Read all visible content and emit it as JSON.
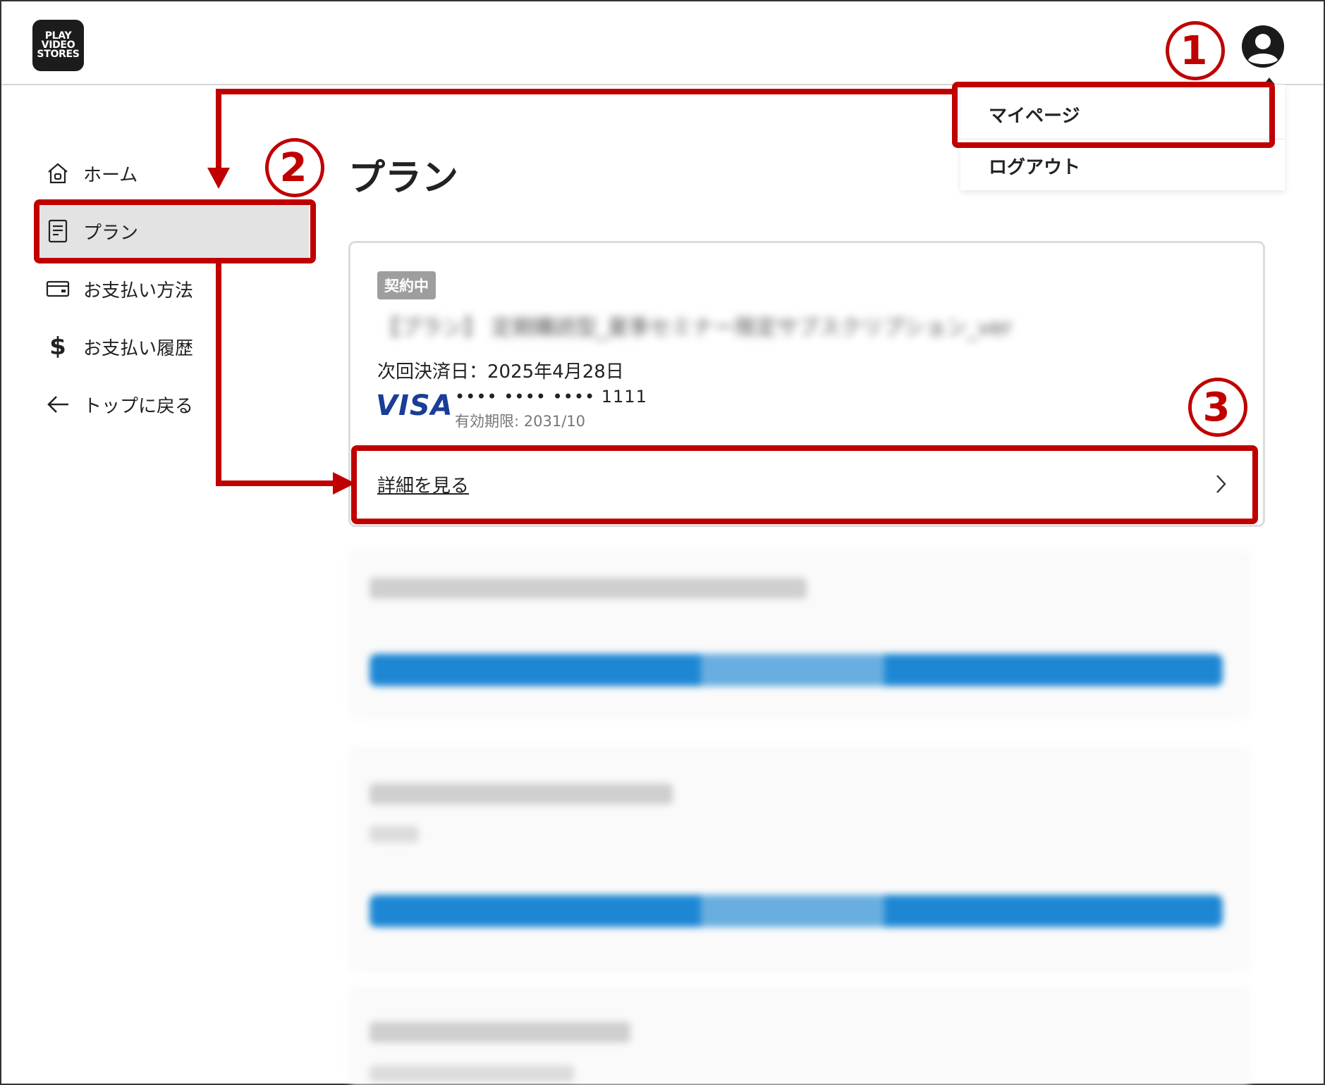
{
  "brand": {
    "logo_lines": [
      "PLAY",
      "VIDEO",
      "STORES"
    ]
  },
  "account_menu": {
    "items": [
      {
        "label": "マイページ"
      },
      {
        "label": "ログアウト"
      }
    ]
  },
  "sidebar": {
    "items": [
      {
        "label": "ホーム",
        "icon": "home-icon"
      },
      {
        "label": "プラン",
        "icon": "document-icon",
        "active": true
      },
      {
        "label": "お支払い方法",
        "icon": "credit-card-icon"
      },
      {
        "label": "お支払い履歴",
        "icon": "dollar-icon"
      },
      {
        "label": "トップに戻る",
        "icon": "arrow-left-icon"
      }
    ]
  },
  "main": {
    "title": "プラン",
    "plan_card": {
      "status_badge": "契約中",
      "plan_name_blurred": "【プラン】 定期購読型_夏季セミナー限定サブスクリプション_ver",
      "next_payment": "次回決済日：2025年4月28日",
      "card_brand": "VISA",
      "card_number": "•••• •••• •••• 1111",
      "card_expiry": "有効期限: 2031/10",
      "details_link": "詳細を見る"
    }
  },
  "annotations": {
    "step1": "1",
    "step2": "2",
    "step3": "3",
    "color": "#c00000"
  },
  "colors": {
    "accent_blue": "#1d87d4",
    "visa_blue": "#1a3d96",
    "badge_gray": "#9e9e9e"
  }
}
